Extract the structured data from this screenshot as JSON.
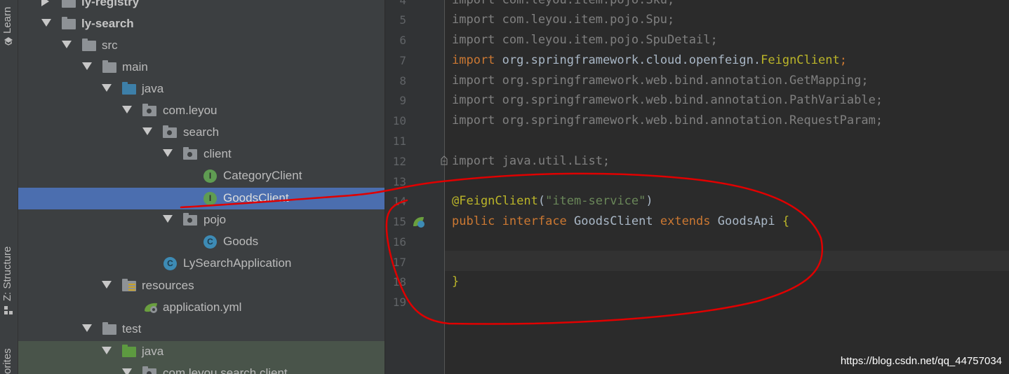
{
  "sidebar_strip": {
    "learn_label": "Learn",
    "structure_label": "Z: Structure",
    "favorites_label": "orites"
  },
  "project_tree": {
    "items": [
      {
        "label": "ly-registry",
        "depth": 0,
        "expanded": false,
        "icon": "module-folder-icon"
      },
      {
        "label": "ly-search",
        "depth": 0,
        "expanded": true,
        "icon": "module-folder-icon"
      },
      {
        "label": "src",
        "depth": 1,
        "expanded": true,
        "icon": "folder-icon"
      },
      {
        "label": "main",
        "depth": 2,
        "expanded": true,
        "icon": "folder-icon"
      },
      {
        "label": "java",
        "depth": 3,
        "expanded": true,
        "icon": "source-folder-icon"
      },
      {
        "label": "com.leyou",
        "depth": 4,
        "expanded": true,
        "icon": "package-icon"
      },
      {
        "label": "search",
        "depth": 5,
        "expanded": true,
        "icon": "package-icon"
      },
      {
        "label": "client",
        "depth": 6,
        "expanded": true,
        "icon": "package-icon"
      },
      {
        "label": "CategoryClient",
        "depth": 7,
        "icon": "interface-icon"
      },
      {
        "label": "GoodsClient",
        "depth": 7,
        "icon": "interface-icon",
        "selected": true
      },
      {
        "label": "pojo",
        "depth": 6,
        "expanded": true,
        "icon": "package-icon"
      },
      {
        "label": "Goods",
        "depth": 7,
        "icon": "class-icon"
      },
      {
        "label": "LySearchApplication",
        "depth": 6,
        "icon": "spring-boot-class-icon"
      },
      {
        "label": "resources",
        "depth": 3,
        "expanded": true,
        "icon": "resources-folder-icon"
      },
      {
        "label": "application.yml",
        "depth": 4,
        "icon": "spring-yml-icon"
      },
      {
        "label": "test",
        "depth": 2,
        "expanded": true,
        "icon": "folder-icon"
      },
      {
        "label": "java",
        "depth": 3,
        "expanded": true,
        "icon": "test-source-folder-icon"
      },
      {
        "label": "com.leyou.search.client",
        "depth": 4,
        "expanded": true,
        "icon": "package-icon"
      }
    ]
  },
  "editor": {
    "lines": [
      {
        "num": "4",
        "text": "import com.leyou.item.pojo.Sku;"
      },
      {
        "num": "5",
        "text": "import com.leyou.item.pojo.Spu;"
      },
      {
        "num": "6",
        "text": "import com.leyou.item.pojo.SpuDetail;"
      },
      {
        "num": "7",
        "text": "import org.springframework.cloud.openfeign.FeignClient;"
      },
      {
        "num": "8",
        "text": "import org.springframework.web.bind.annotation.GetMapping;"
      },
      {
        "num": "9",
        "text": "import org.springframework.web.bind.annotation.PathVariable;"
      },
      {
        "num": "10",
        "text": "import org.springframework.web.bind.annotation.RequestParam;"
      },
      {
        "num": "11",
        "text": ""
      },
      {
        "num": "12",
        "text": "import java.util.List;"
      },
      {
        "num": "13",
        "text": ""
      },
      {
        "num": "14",
        "text": "@FeignClient(\"item-service\")"
      },
      {
        "num": "15",
        "text": "public interface GoodsClient extends GoodsApi {"
      },
      {
        "num": "16",
        "text": ""
      },
      {
        "num": "17",
        "text": ""
      },
      {
        "num": "18",
        "text": "}"
      },
      {
        "num": "19",
        "text": ""
      }
    ]
  },
  "watermark": "https://blog.csdn.net/qq_44757034",
  "colors": {
    "keyword": "#cc7832",
    "annotation": "#bbb529",
    "string": "#6a8759",
    "selection": "#4b6eaf",
    "annotation_mark": "#e00000"
  }
}
